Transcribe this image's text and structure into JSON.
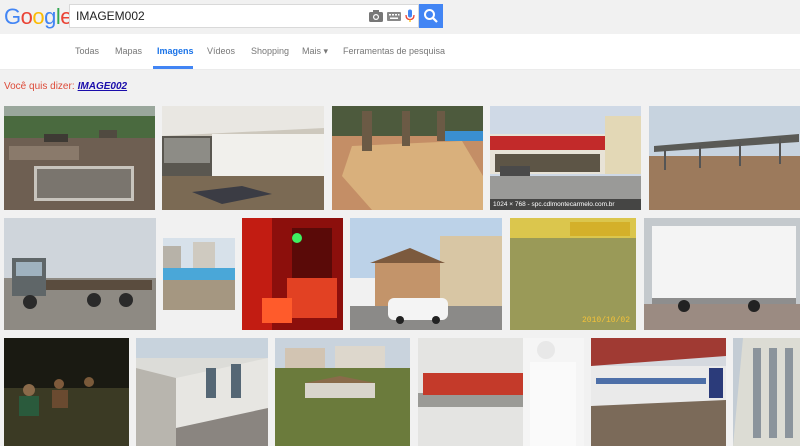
{
  "logo": {
    "letters": [
      "G",
      "o",
      "o",
      "g",
      "l",
      "e"
    ],
    "colors": [
      "#4285f4",
      "#ea4335",
      "#fbbc05",
      "#4285f4",
      "#34a853",
      "#ea4335"
    ]
  },
  "search": {
    "value": "IMAGEM002"
  },
  "tabs": [
    {
      "label": "Todas"
    },
    {
      "label": "Mapas"
    },
    {
      "label": "Imagens"
    },
    {
      "label": "Vídeos"
    },
    {
      "label": "Shopping"
    },
    {
      "label": "Mais ▾"
    },
    {
      "label": "Ferramentas de pesquisa"
    }
  ],
  "active_tab": "Imagens",
  "did_you_mean": {
    "label": "Você quis dizer:",
    "suggestion": "IMAGE002"
  },
  "results": [
    {
      "name": "construction-site"
    },
    {
      "name": "empty-room"
    },
    {
      "name": "tiled-planter"
    },
    {
      "name": "storefront",
      "caption": "1024 × 768 - spc.cdlmontecarmelo.com.br"
    },
    {
      "name": "shed-structure"
    },
    {
      "name": "truck-flatbed"
    },
    {
      "name": "pool-area"
    },
    {
      "name": "red-lit-room"
    },
    {
      "name": "street-houses"
    },
    {
      "name": "flooded-pool",
      "stamp": "2010/10/02"
    },
    {
      "name": "box-truck"
    },
    {
      "name": "night-group"
    },
    {
      "name": "building-corridor"
    },
    {
      "name": "field-houses"
    },
    {
      "name": "lab-worker"
    },
    {
      "name": "empty-hall"
    },
    {
      "name": "building-facade"
    }
  ],
  "colors": {
    "accent": "#4285f4",
    "suggestion_label": "#dd4b39",
    "link": "#1a0dab"
  }
}
